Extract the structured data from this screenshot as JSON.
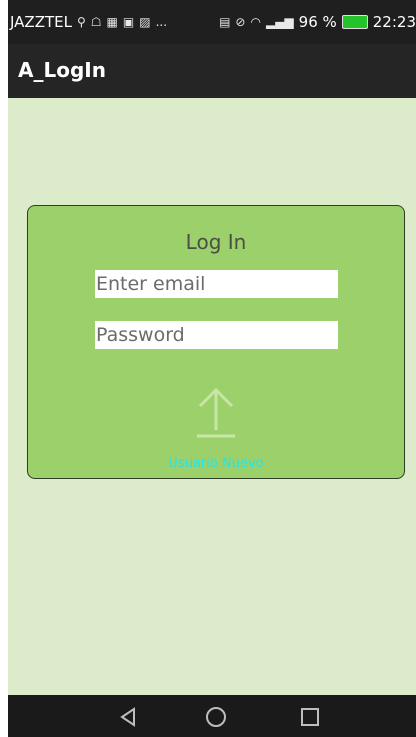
{
  "status_bar": {
    "carrier": "JAZZTEL",
    "battery": "96 %",
    "time": "22:23",
    "icons_left": [
      "usb-icon",
      "android-icon",
      "facebook-icon",
      "image-icon",
      "image-edit-icon",
      "more-icon"
    ],
    "icons_right": [
      "nfc-icon",
      "vibrate-icon",
      "wifi-icon",
      "signal-icon",
      "battery-icon"
    ],
    "more_label": "..."
  },
  "app_bar": {
    "title": "A_LogIn"
  },
  "login": {
    "title": "Log In",
    "email_placeholder": "Enter email",
    "password_placeholder": "Password",
    "upload_icon": "upload-arrow-icon",
    "new_user_label": "Usuario Nuevo"
  },
  "nav": {
    "back_icon": "back-triangle-icon",
    "home_icon": "home-circle-icon",
    "recents_icon": "recents-square-icon"
  },
  "colors": {
    "background": "#dcebc9",
    "card": "#9cd06a",
    "app_bar": "#252525",
    "status_bar": "#1f1f1f",
    "accent_text": "#22e6ee"
  }
}
